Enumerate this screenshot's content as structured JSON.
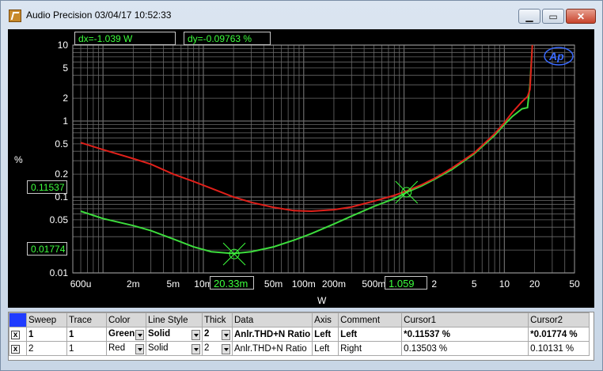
{
  "window": {
    "title": "Audio Precision  03/04/17 10:52:33"
  },
  "readouts": {
    "dx": "dx=-1.039  W",
    "dy": "dy=-0.09763 %",
    "y_cursor1": "0.11537",
    "y_cursor2": "0.01774",
    "x_cursor1": "20.33m",
    "x_cursor2": "1.059"
  },
  "colors": {
    "series1": "#3ddc3d",
    "series2": "#e0201a",
    "plot_bg": "#000000",
    "grid": "#6a6a6a"
  },
  "chart_data": {
    "type": "line",
    "xlabel": "W",
    "ylabel": "%",
    "xscale": "log",
    "yscale": "log",
    "xlim": [
      0.0005,
      50
    ],
    "ylim": [
      0.01,
      10
    ],
    "x_tick_labels": [
      "600u",
      "2m",
      "5m",
      "10m",
      "50m",
      "100m",
      "200m",
      "500m",
      "2",
      "5",
      "10",
      "20",
      "50"
    ],
    "y_tick_labels": [
      "10",
      "5",
      "2",
      "1",
      "0.5",
      "0.2",
      "0.1",
      "0.05",
      "0.01"
    ],
    "series": [
      {
        "name": "",
        "color": "green",
        "x": [
          0.0006,
          0.001,
          0.002,
          0.003,
          0.005,
          0.008,
          0.012,
          0.02,
          0.03,
          0.05,
          0.08,
          0.12,
          0.2,
          0.3,
          0.5,
          0.8,
          1.06,
          1.5,
          2,
          3,
          5,
          8,
          10,
          12,
          15,
          17,
          18,
          19
        ],
        "y": [
          0.065,
          0.052,
          0.042,
          0.036,
          0.028,
          0.022,
          0.019,
          0.018,
          0.019,
          0.022,
          0.027,
          0.033,
          0.044,
          0.056,
          0.075,
          0.095,
          0.115,
          0.14,
          0.17,
          0.23,
          0.37,
          0.65,
          0.9,
          1.15,
          1.45,
          1.5,
          3,
          10
        ]
      },
      {
        "name": "",
        "color": "red",
        "x": [
          0.0006,
          0.001,
          0.002,
          0.003,
          0.005,
          0.008,
          0.012,
          0.02,
          0.03,
          0.05,
          0.08,
          0.12,
          0.2,
          0.3,
          0.5,
          0.8,
          1.06,
          1.5,
          2,
          3,
          5,
          8,
          10,
          12,
          15,
          17,
          18,
          19
        ],
        "y": [
          0.52,
          0.42,
          0.32,
          0.27,
          0.2,
          0.16,
          0.13,
          0.1,
          0.085,
          0.073,
          0.066,
          0.065,
          0.068,
          0.074,
          0.088,
          0.105,
          0.12,
          0.145,
          0.175,
          0.24,
          0.38,
          0.68,
          0.95,
          1.3,
          1.8,
          2.1,
          2.6,
          10
        ]
      }
    ],
    "cursors": [
      {
        "x": 0.02033,
        "y": 0.01774
      },
      {
        "x": 1.059,
        "y": 0.11537
      }
    ]
  },
  "table": {
    "headers": [
      "Sweep",
      "Trace",
      "Color",
      "Line Style",
      "Thick",
      "Data",
      "Axis",
      "Comment",
      "Cursor1",
      "Cursor2"
    ],
    "rows": [
      {
        "check": "x",
        "sweep": "1",
        "trace": "1",
        "color": "Green",
        "style": "Solid",
        "thick": "2",
        "data": "Anlr.THD+N Ratio",
        "axis": "Left",
        "comment": "Left",
        "cursor1": "*0.11537  %",
        "cursor2": "*0.01774  %"
      },
      {
        "check": "x",
        "sweep": "2",
        "trace": "1",
        "color": "Red",
        "style": "Solid",
        "thick": "2",
        "data": "Anlr.THD+N Ratio",
        "axis": "Left",
        "comment": "Right",
        "cursor1": "0.13503  %",
        "cursor2": "0.10131  %"
      }
    ]
  }
}
